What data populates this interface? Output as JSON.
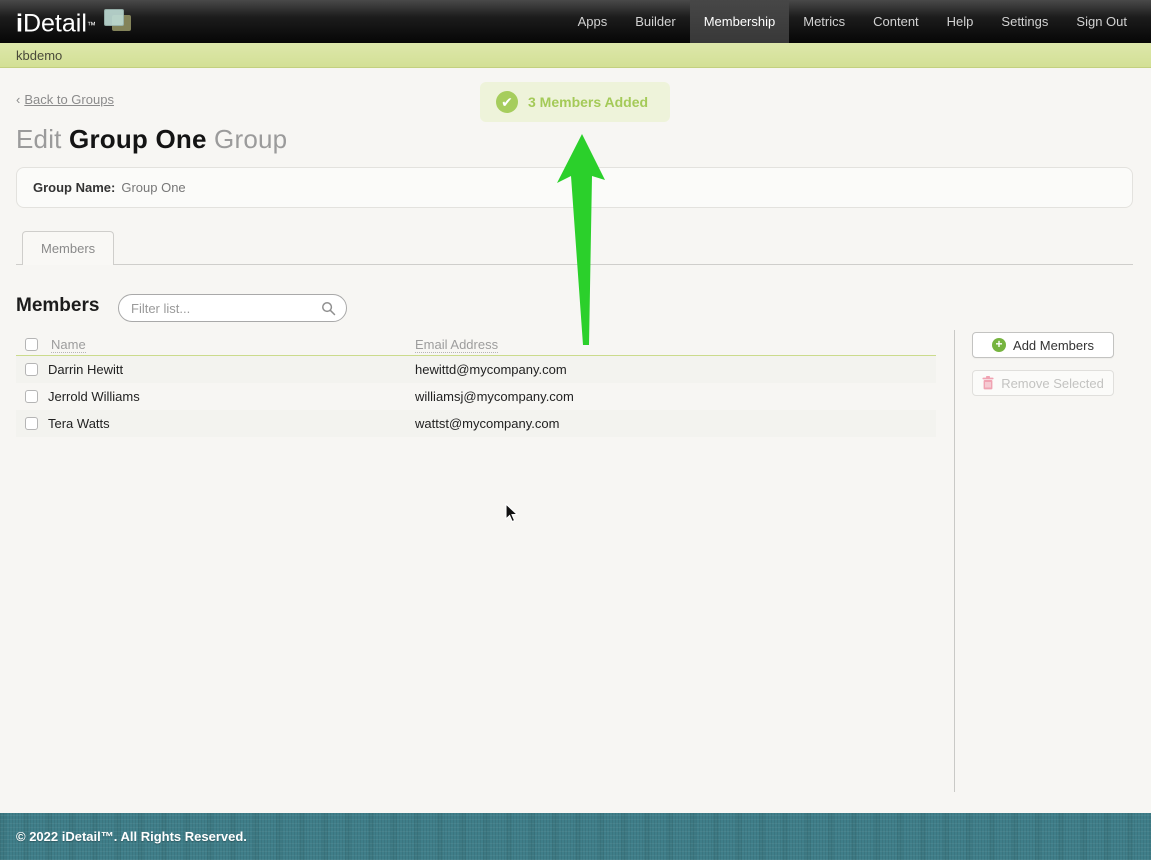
{
  "navbar": {
    "logo": {
      "text_i": "i",
      "text_detail": "Detail",
      "tm": "™"
    },
    "items": [
      {
        "label": "Apps",
        "active": false
      },
      {
        "label": "Builder",
        "active": false
      },
      {
        "label": "Membership",
        "active": true
      },
      {
        "label": "Metrics",
        "active": false
      },
      {
        "label": "Content",
        "active": false
      },
      {
        "label": "Help",
        "active": false
      },
      {
        "label": "Settings",
        "active": false
      },
      {
        "label": "Sign Out",
        "active": false
      }
    ]
  },
  "subnav": {
    "label": "kbdemo"
  },
  "page": {
    "back_link": {
      "chevron": "‹",
      "label": "Back to Groups"
    },
    "notification": {
      "icon": "check-circle",
      "text": "3 Members Added",
      "check": "✔"
    },
    "title": {
      "prefix": "Edit ",
      "name": "Group One",
      "suffix": " Group"
    },
    "group_field": {
      "label": "Group Name:",
      "value": "Group One"
    },
    "tab_label": "Members",
    "members": {
      "heading": "Members",
      "filter_placeholder": "Filter list...",
      "columns": {
        "name": "Name",
        "email": "Email Address"
      },
      "rows": [
        {
          "name": "Darrin Hewitt",
          "email": "hewittd@mycompany.com",
          "checked": false
        },
        {
          "name": "Jerrold Williams",
          "email": "williamsj@mycompany.com",
          "checked": false
        },
        {
          "name": "Tera Watts",
          "email": "wattst@mycompany.com",
          "checked": false
        }
      ],
      "buttons": {
        "add": {
          "label": "Add Members",
          "icon": "plus-circle",
          "plus": "+",
          "enabled": true
        },
        "remove": {
          "label": "Remove Selected",
          "icon": "trash",
          "enabled": false
        }
      }
    }
  },
  "footer": {
    "text": "© 2022 iDetail™.  All Rights Reserved."
  },
  "colors": {
    "accent_green": "#a6cd5d",
    "arrow_green": "#2bd02b",
    "subnav_green": "#d6e29d",
    "header_separator": "#cbdb8c",
    "footer_teal": "#3f7e89",
    "add_icon_green": "#76b43f",
    "trash_pink": "#f0a3b2"
  }
}
